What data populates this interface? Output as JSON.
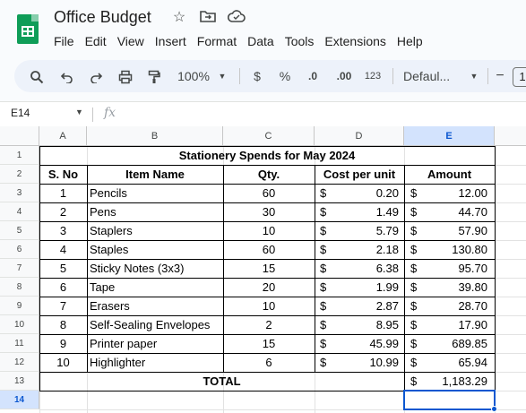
{
  "app": {
    "title": "Office Budget",
    "menus": [
      "File",
      "Edit",
      "View",
      "Insert",
      "Format",
      "Data",
      "Tools",
      "Extensions",
      "Help"
    ]
  },
  "toolbar": {
    "zoom": "100%",
    "currency": "$",
    "percent": "%",
    "decrease_decimal": ".0",
    "increase_decimal": ".00",
    "number_format": "123",
    "font": "Defaul...",
    "font_size_minus": "−",
    "font_size_value": "1"
  },
  "formula_bar": {
    "cell_ref": "E14",
    "fx": "fx",
    "content": ""
  },
  "columns": [
    "A",
    "B",
    "C",
    "D",
    "E"
  ],
  "rows": [
    "1",
    "2",
    "3",
    "4",
    "5",
    "6",
    "7",
    "8",
    "9",
    "10",
    "11",
    "12",
    "13",
    "14"
  ],
  "sheet": {
    "heading": "Stationery Spends for May 2024",
    "headers": {
      "sno": "S. No",
      "item": "Item Name",
      "qty": "Qty.",
      "cost": "Cost per unit",
      "amount": "Amount"
    },
    "currency": "$",
    "items": [
      {
        "sno": "1",
        "item": "Pencils",
        "qty": "60",
        "cost": "0.20",
        "amount": "12.00"
      },
      {
        "sno": "2",
        "item": "Pens",
        "qty": "30",
        "cost": "1.49",
        "amount": "44.70"
      },
      {
        "sno": "3",
        "item": "Staplers",
        "qty": "10",
        "cost": "5.79",
        "amount": "57.90"
      },
      {
        "sno": "4",
        "item": "Staples",
        "qty": "60",
        "cost": "2.18",
        "amount": "130.80"
      },
      {
        "sno": "5",
        "item": "Sticky Notes (3x3)",
        "qty": "15",
        "cost": "6.38",
        "amount": "95.70"
      },
      {
        "sno": "6",
        "item": "Tape",
        "qty": "20",
        "cost": "1.99",
        "amount": "39.80"
      },
      {
        "sno": "7",
        "item": "Erasers",
        "qty": "10",
        "cost": "2.87",
        "amount": "28.70"
      },
      {
        "sno": "8",
        "item": "Self-Sealing Envelopes",
        "qty": "2",
        "cost": "8.95",
        "amount": "17.90"
      },
      {
        "sno": "9",
        "item": "Printer paper",
        "qty": "15",
        "cost": "45.99",
        "amount": "689.85"
      },
      {
        "sno": "10",
        "item": "Highlighter",
        "qty": "6",
        "cost": "10.99",
        "amount": "65.94"
      }
    ],
    "total_label": "TOTAL",
    "total_amount": "1,183.29"
  },
  "colors": {
    "brand": "#0f9d58",
    "selection": "#0b57d0",
    "selection_header": "#d3e3fd"
  }
}
